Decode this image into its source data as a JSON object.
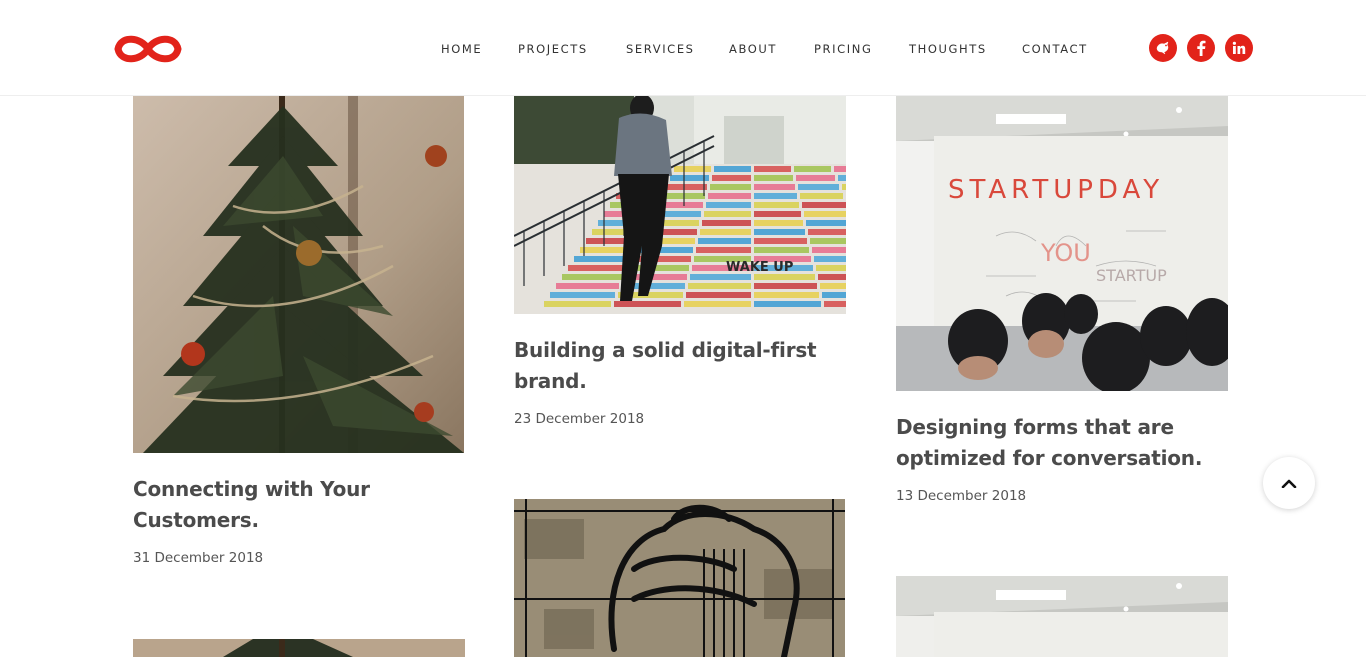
{
  "header": {
    "logo_name": "infinity-logo",
    "accent_color": "#e2231a",
    "nav": [
      "HOME",
      "PROJECTS",
      "SERVICES",
      "ABOUT",
      "PRICING",
      "THOUGHTS",
      "CONTACT"
    ],
    "social": [
      "bird-icon",
      "facebook-icon",
      "linkedin-icon"
    ]
  },
  "posts": [
    {
      "title": "Connecting with Your Customers.",
      "date": "31 December 2018",
      "image": "christmas-tree"
    },
    {
      "title": "Building a solid digital-first brand.",
      "date": "23 December 2018",
      "image": "colorful-stairs"
    },
    {
      "title": "Designing forms that are optimized for conversation.",
      "date": "13 December 2018",
      "image": "startup-day-whiteboard"
    }
  ],
  "whiteboard_text": "STARTUPDAY",
  "stairs_graffiti": "WAKE UP",
  "back_to_top_icon": "chevron-up-icon"
}
